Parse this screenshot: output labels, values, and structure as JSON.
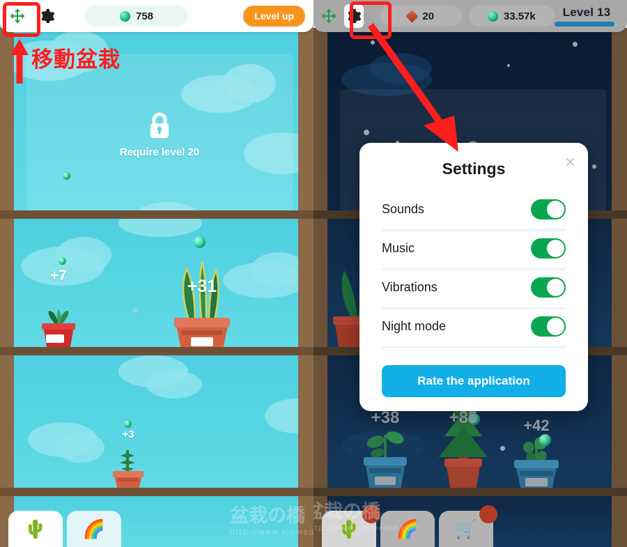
{
  "left_panel": {
    "topbar": {
      "move_icon": "move-arrows-icon",
      "gear_icon": "gear-icon",
      "currency_label": "758",
      "currency_icon": "green-gem-icon",
      "levelup_label": "Level up"
    },
    "annotation": {
      "text": "移動盆栽",
      "color": "#ff1d1d"
    },
    "shelves": [
      {
        "locked": true,
        "lock_icon": "lock-icon",
        "lock_text": "Require level 20",
        "plants": []
      },
      {
        "locked": false,
        "plants": [
          {
            "gain": "+7",
            "pot_color": "#cf2b2b",
            "type": "small-succulent"
          },
          {
            "gain": "+31",
            "pot_color": "#d4603f",
            "type": "snake-plant"
          }
        ]
      },
      {
        "locked": false,
        "plants": [
          {
            "gain": "+3",
            "pot_color": "#d4603f",
            "type": "sprout"
          }
        ]
      },
      {
        "locked": false,
        "plants": []
      }
    ],
    "bottom_nav": [
      {
        "icon": "cactus-icon",
        "glyph": "🌵",
        "active": true,
        "badge": false
      },
      {
        "icon": "rainbow-icon",
        "glyph": "🌈",
        "active": false,
        "badge": false
      }
    ]
  },
  "right_panel": {
    "topbar": {
      "move_icon": "move-arrows-icon",
      "gear_icon": "gear-icon",
      "diamond_label": "20",
      "diamond_icon": "red-diamond-icon",
      "gem_label": "33.57k",
      "gem_icon": "green-gem-icon",
      "level_label": "Level 13",
      "level_progress_percent": 93
    },
    "shelves": [
      {
        "locked": true,
        "lock_icon": "lock-icon",
        "plants": []
      },
      {
        "locked": false,
        "plants": [
          {
            "gain": "+38",
            "pot_color": "#2f6f94",
            "type": "sprout"
          },
          {
            "gain": "+85",
            "pot_color": "#a3412f",
            "type": "pine-tree"
          },
          {
            "gain": "+42",
            "pot_color": "#2f6f94",
            "type": "leafy"
          }
        ]
      }
    ],
    "bottom_nav": [
      {
        "icon": "cactus-icon",
        "glyph": "🌵",
        "active": true,
        "badge": true
      },
      {
        "icon": "rainbow-icon",
        "glyph": "🌈",
        "active": false,
        "badge": false
      },
      {
        "icon": "shopping-cart-icon",
        "glyph": "🛒",
        "active": false,
        "badge": true
      }
    ],
    "settings_dialog": {
      "title": "Settings",
      "close_label": "×",
      "rows": [
        {
          "label": "Sounds",
          "on": true
        },
        {
          "label": "Music",
          "on": true
        },
        {
          "label": "Vibrations",
          "on": true
        },
        {
          "label": "Night mode",
          "on": true
        }
      ],
      "rate_button": "Rate the application",
      "toggle_on_color": "#0aa550",
      "rate_button_color": "#12afe8"
    }
  },
  "watermark": {
    "big": "盆栽の橋",
    "small": "http://www.xinmedia.com"
  }
}
